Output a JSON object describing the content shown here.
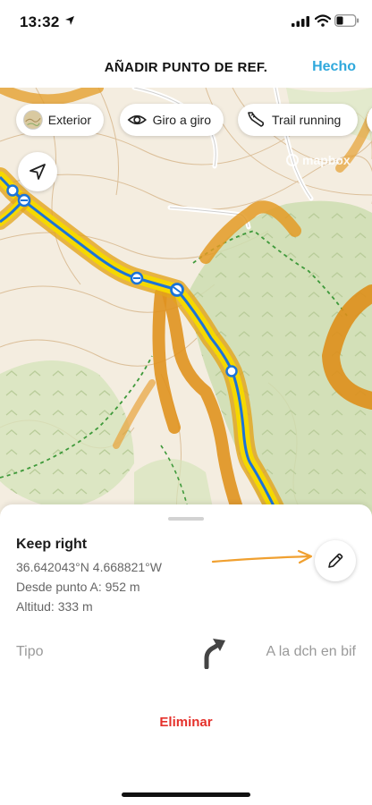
{
  "status_bar": {
    "time": "13:32"
  },
  "nav": {
    "title": "AÑADIR PUNTO DE REF.",
    "done_label": "Hecho"
  },
  "map": {
    "chips": [
      {
        "label": "Exterior",
        "icon": "terrain-thumbnail-icon"
      },
      {
        "label": "Giro a giro",
        "icon": "eye-icon"
      },
      {
        "label": "Trail running",
        "icon": "shoe-icon"
      }
    ],
    "attribution": "mapbox"
  },
  "waypoint": {
    "name": "Keep right",
    "coordinates": "36.642043°N 4.668821°W",
    "distance": "Desde punto A: 952 m",
    "altitude": "Altitud: 333 m"
  },
  "type_row": {
    "label": "Tipo",
    "value": "A la dch en bif",
    "icon": "keep-right-arrow-icon"
  },
  "delete_label": "Eliminar",
  "colors": {
    "accent": "#2fa8dc",
    "delete": "#e5312b",
    "route": "#1a73d9",
    "heat": "#f2d300",
    "annotation": "#f0a030"
  }
}
